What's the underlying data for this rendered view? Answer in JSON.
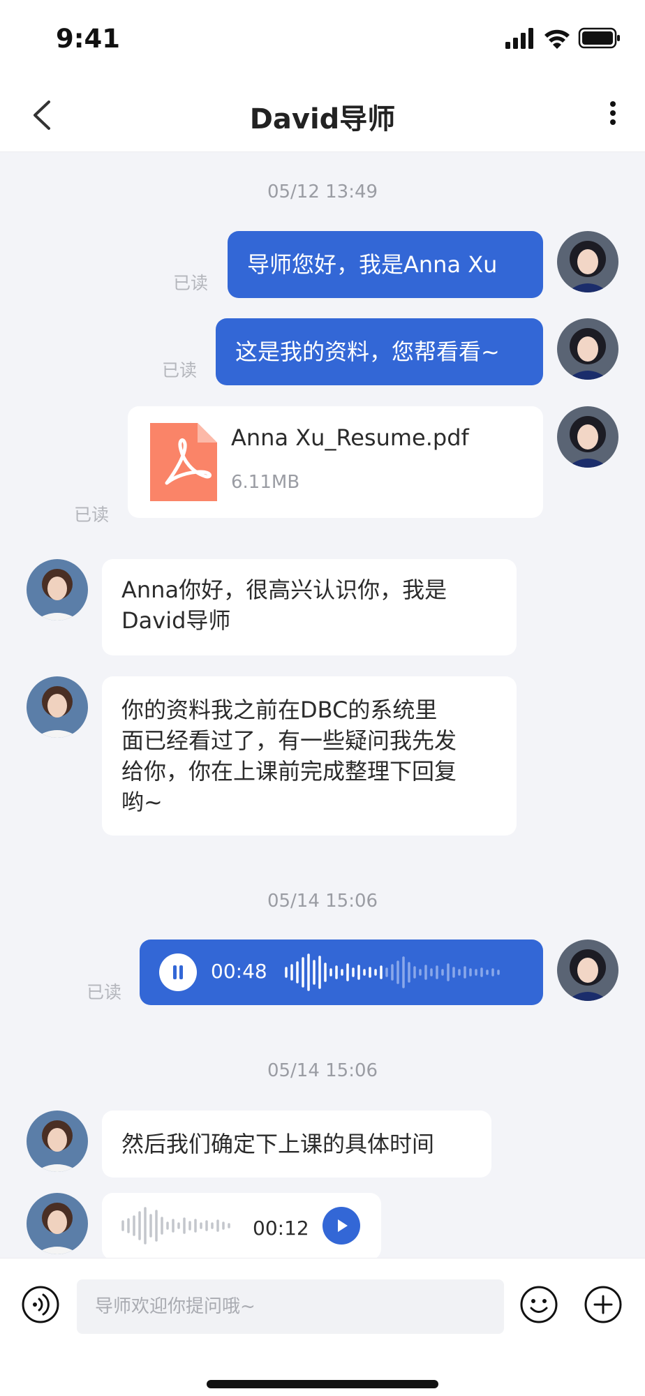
{
  "status_bar": {
    "time": "9:41"
  },
  "nav": {
    "title": "David导师"
  },
  "chat": {
    "timestamps": [
      "05/12 13:49",
      "05/14 15:06",
      "05/14 15:06"
    ],
    "read_label": "已读",
    "messages": {
      "m1": "导师您好，我是Anna Xu",
      "m2": "这是我的资料，您帮看看~",
      "m4_line1": "Anna你好，很高兴认识你，我是",
      "m4_line2": "David导师",
      "m5_line1": "你的资料我之前在DBC的系统里",
      "m5_line2": "面已经看过了，有一些疑问我先发",
      "m5_line3": "给你，你在上课前完成整理下回复",
      "m5_line4": "哟~",
      "m7": "然后我们确定下上课的具体时间"
    },
    "file": {
      "name": "Anna Xu_Resume.pdf",
      "size": "6.11MB",
      "icon": "pdf-icon"
    },
    "voice_sent": {
      "duration": "00:48",
      "state": "playing"
    },
    "voice_received": {
      "duration": "00:12",
      "state": "paused"
    }
  },
  "input": {
    "placeholder": "导师欢迎你提问哦~"
  },
  "colors": {
    "accent": "#3367d6",
    "background": "#f3f4f8",
    "file_icon": "#fa8468"
  }
}
